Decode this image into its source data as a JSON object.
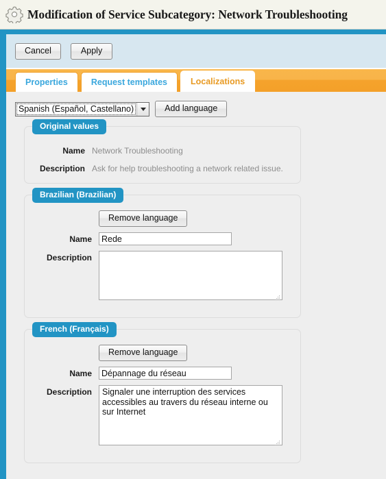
{
  "window": {
    "title": "Modification of Service Subcategory: Network Troubleshooting",
    "icon": "gear-icon"
  },
  "toolbar": {
    "cancel_label": "Cancel",
    "apply_label": "Apply"
  },
  "tabs": [
    {
      "label": "Properties",
      "active": false
    },
    {
      "label": "Request templates",
      "active": false
    },
    {
      "label": "Localizations",
      "active": true
    }
  ],
  "language_selector": {
    "selected": "Spanish (Español, Castellano)",
    "add_button_label": "Add language",
    "caret_icon": "chevron-down-icon"
  },
  "original_values": {
    "badge": "Original values",
    "name_label": "Name",
    "name_value": "Network Troubleshooting",
    "description_label": "Description",
    "description_value": "Ask for help troubleshooting a network related issue."
  },
  "localizations": [
    {
      "badge": "Brazilian (Brazilian)",
      "remove_label": "Remove language",
      "name_label": "Name",
      "name_value": "Rede",
      "description_label": "Description",
      "description_value": ""
    },
    {
      "badge": "French (Français)",
      "remove_label": "Remove language",
      "name_label": "Name",
      "name_value": "Dépannage du réseau",
      "description_label": "Description",
      "description_value": "Signaler une interruption des services accessibles au travers du réseau interne ou sur Internet"
    }
  ],
  "colors": {
    "accent_blue": "#2294c4",
    "tab_orange": "#f5a62f",
    "toolbar_blue": "#d7e7f0",
    "panel_grey": "#eeeeee"
  }
}
